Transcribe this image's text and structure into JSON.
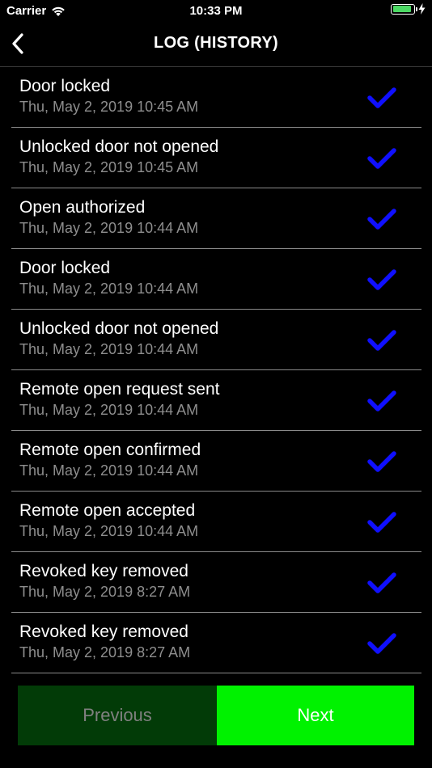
{
  "status_bar": {
    "carrier": "Carrier",
    "time": "10:33 PM"
  },
  "nav": {
    "title": "LOG (HISTORY)"
  },
  "log": [
    {
      "title": "Door locked",
      "time": "Thu, May 2, 2019 10:45 AM"
    },
    {
      "title": "Unlocked door not opened",
      "time": "Thu, May 2, 2019 10:45 AM"
    },
    {
      "title": "Open authorized",
      "time": "Thu, May 2, 2019 10:44 AM"
    },
    {
      "title": "Door locked",
      "time": "Thu, May 2, 2019 10:44 AM"
    },
    {
      "title": "Unlocked door not opened",
      "time": "Thu, May 2, 2019 10:44 AM"
    },
    {
      "title": "Remote open request sent",
      "time": "Thu, May 2, 2019 10:44 AM"
    },
    {
      "title": "Remote open confirmed",
      "time": "Thu, May 2, 2019 10:44 AM"
    },
    {
      "title": "Remote open accepted",
      "time": "Thu, May 2, 2019 10:44 AM"
    },
    {
      "title": "Revoked key removed",
      "time": "Thu, May 2, 2019 8:27 AM"
    },
    {
      "title": "Revoked key removed",
      "time": "Thu, May 2, 2019 8:27 AM"
    }
  ],
  "buttons": {
    "previous": "Previous",
    "next": "Next"
  },
  "colors": {
    "check": "#1010ff",
    "next_bg": "#00f200",
    "previous_bg": "#023b07"
  }
}
